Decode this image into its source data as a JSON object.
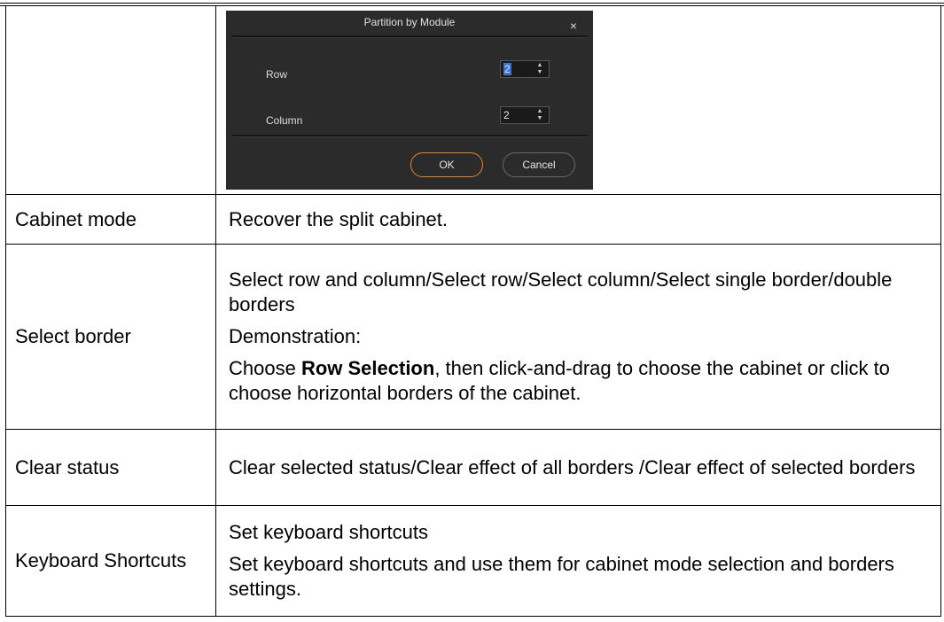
{
  "dialog": {
    "title": "Partition by Module",
    "close_glyph": "×",
    "row_label": "Row",
    "row_value": "2",
    "column_label": "Column",
    "column_value": "2",
    "spin_up_glyph": "▲",
    "spin_down_glyph": "▼",
    "ok_label": "OK",
    "cancel_label": "Cancel",
    "accent_color": "#e8842c",
    "background_color": "#2b2b2b"
  },
  "rows": [
    {
      "label": "Cabinet mode",
      "paragraphs": [
        "Recover the split cabinet."
      ]
    },
    {
      "label": "Select border",
      "paragraphs": [
        "Select row and column/Select row/Select column/Select single border/double borders",
        "Demonstration:"
      ],
      "choose_prefix": "Choose ",
      "choose_bold": "Row Selection",
      "choose_suffix": ", then click-and-drag to choose the cabinet or click to choose horizontal borders of the cabinet."
    },
    {
      "label": "Clear status",
      "paragraphs": [
        "Clear selected status/Clear effect of all borders /Clear effect of selected borders"
      ]
    },
    {
      "label": "Keyboard Shortcuts",
      "paragraphs": [
        "Set keyboard shortcuts",
        "Set keyboard shortcuts and use them for cabinet mode selection and borders settings."
      ]
    }
  ]
}
